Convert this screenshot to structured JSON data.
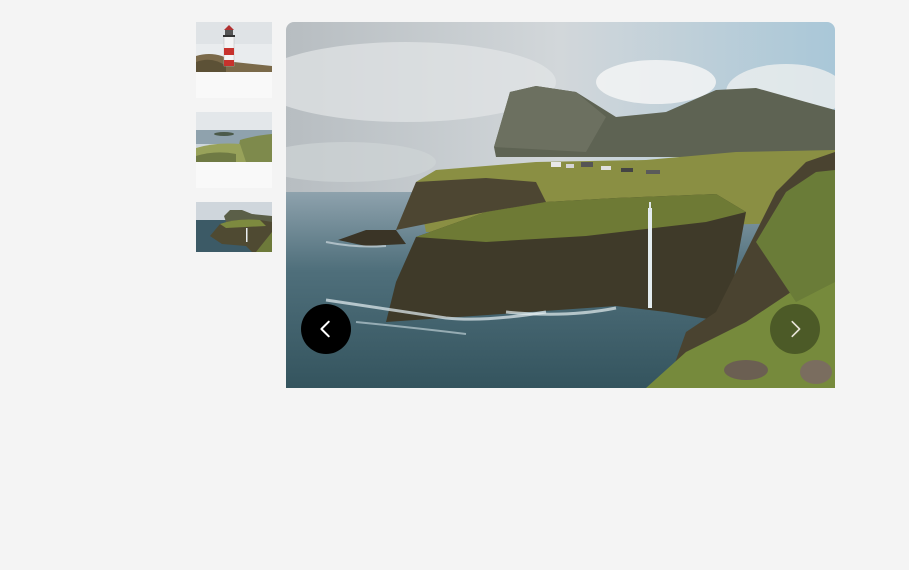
{
  "gallery": {
    "thumbnails": [
      {
        "icon": "lighthouse-image",
        "selected": false
      },
      {
        "icon": "coastline-island-image",
        "selected": false
      },
      {
        "icon": "waterfall-cliff-image",
        "selected": true
      }
    ],
    "main_image": {
      "icon": "waterfall-cliff-landscape-image"
    },
    "prev_button": {
      "icon": "chevron-left-icon",
      "color": "#000000"
    },
    "next_button": {
      "icon": "chevron-right-icon",
      "color": "#3a3a2a"
    }
  }
}
